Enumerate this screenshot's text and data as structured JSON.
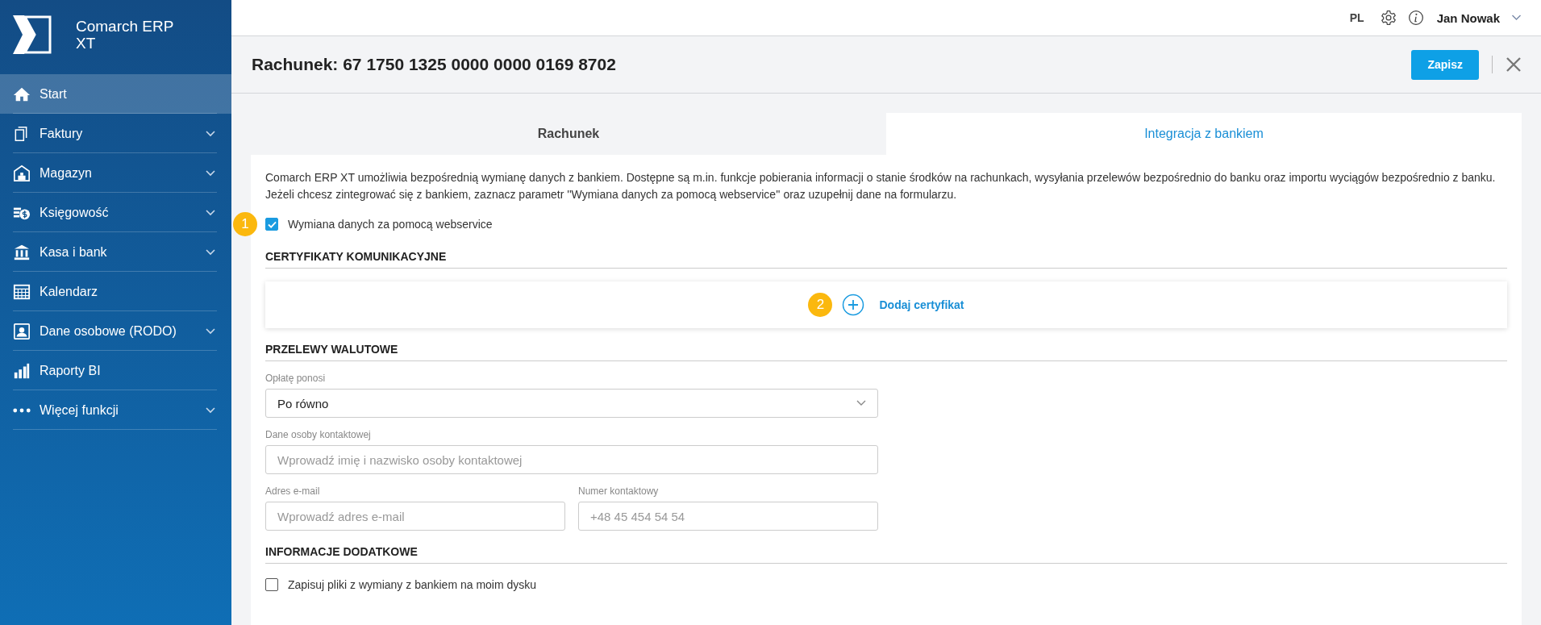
{
  "app": {
    "name_lines": [
      "Comarch ERP",
      "XT"
    ]
  },
  "sidebar": {
    "items": [
      {
        "label": "Start",
        "expandable": false,
        "selected": true
      },
      {
        "label": "Faktury",
        "expandable": true,
        "selected": false
      },
      {
        "label": "Magazyn",
        "expandable": true,
        "selected": false
      },
      {
        "label": "Księgowość",
        "expandable": true,
        "selected": false
      },
      {
        "label": "Kasa i bank",
        "expandable": true,
        "selected": false
      },
      {
        "label": "Kalendarz",
        "expandable": false,
        "selected": false
      },
      {
        "label": "Dane osobowe (RODO)",
        "expandable": true,
        "selected": false
      },
      {
        "label": "Raporty BI",
        "expandable": false,
        "selected": false
      },
      {
        "label": "Więcej funkcji",
        "expandable": true,
        "selected": false
      }
    ]
  },
  "topbar": {
    "language": "PL",
    "user": "Jan Nowak"
  },
  "header": {
    "title": "Rachunek: 67 1750 1325 0000 0000 0169 8702",
    "save_button": "Zapisz"
  },
  "tabs": [
    {
      "label": "Rachunek",
      "selected": false
    },
    {
      "label": "Integracja z bankiem",
      "selected": true
    }
  ],
  "intro": "Comarch ERP XT umożliwia bezpośrednią wymianę danych z bankiem. Dostępne są m.in. funkcje pobierania informacji o stanie środków na rachunkach, wysyłania przelewów bezpośrednio do banku oraz importu wyciągów bezpośrednio z banku. Jeżeli chcesz zintegrować się z bankiem, zaznacz parametr ''Wymiana danych za pomocą webservice'' oraz uzupełnij dane na formularzu.",
  "webservice": {
    "badge": "1",
    "label": "Wymiana danych za pomocą webservice",
    "checked": true
  },
  "certificates": {
    "heading": "CERTYFIKATY KOMUNIKACYJNE",
    "badge": "2",
    "add_link": "Dodaj certyfikat"
  },
  "transfers": {
    "heading": "PRZELEWY WALUTOWE",
    "fee": {
      "label": "Opłatę ponosi",
      "value": "Po równo"
    },
    "contact": {
      "label": "Dane osoby kontaktowej",
      "placeholder": "Wprowadź imię i nazwisko osoby kontaktowej"
    },
    "email": {
      "label": "Adres e-mail",
      "placeholder": "Wprowadź adres e-mail"
    },
    "phone": {
      "label": "Numer kontaktowy",
      "placeholder": "+48 45 454 54 54"
    }
  },
  "extra": {
    "heading": "INFORMACJE DODATKOWE",
    "label": "Zapisuj pliki z wymiany z bankiem na moim dysku",
    "checked": false
  }
}
